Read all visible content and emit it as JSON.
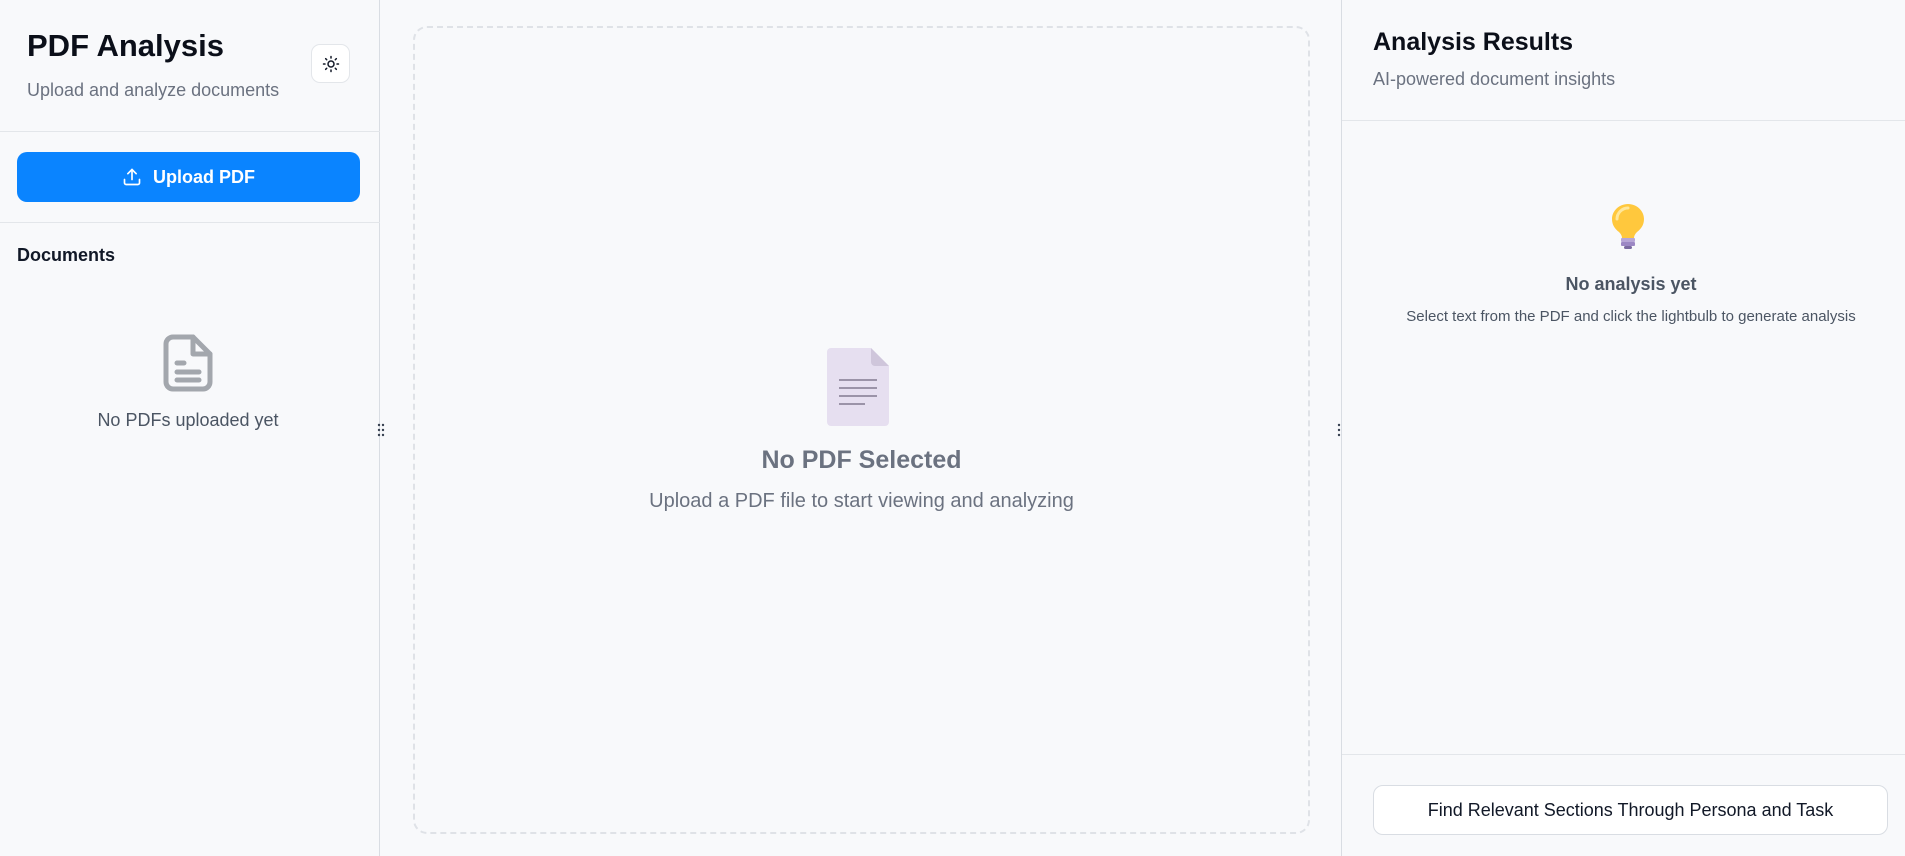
{
  "sidebar": {
    "title": "PDF Analysis",
    "subtitle": "Upload and analyze documents",
    "theme_toggle_icon": "sun-icon",
    "upload_button": {
      "label": "Upload PDF",
      "icon": "upload-icon"
    },
    "documents_heading": "Documents",
    "empty_icon": "file-text-icon",
    "empty_text": "No PDFs uploaded yet"
  },
  "viewer": {
    "icon": "document-icon",
    "title": "No PDF Selected",
    "subtitle": "Upload a PDF file to start viewing and analyzing"
  },
  "results": {
    "title": "Analysis Results",
    "subtitle": "AI-powered document insights",
    "empty_icon": "lightbulb-icon",
    "empty_title": "No analysis yet",
    "empty_text": "Select text from the PDF and click the lightbulb to generate analysis",
    "persona_button": "Find Relevant Sections Through Persona and Task"
  },
  "colors": {
    "accent": "#0a84ff",
    "background": "#f8f9fb",
    "border": "#d9dde3",
    "muted_text": "#6b7280"
  }
}
